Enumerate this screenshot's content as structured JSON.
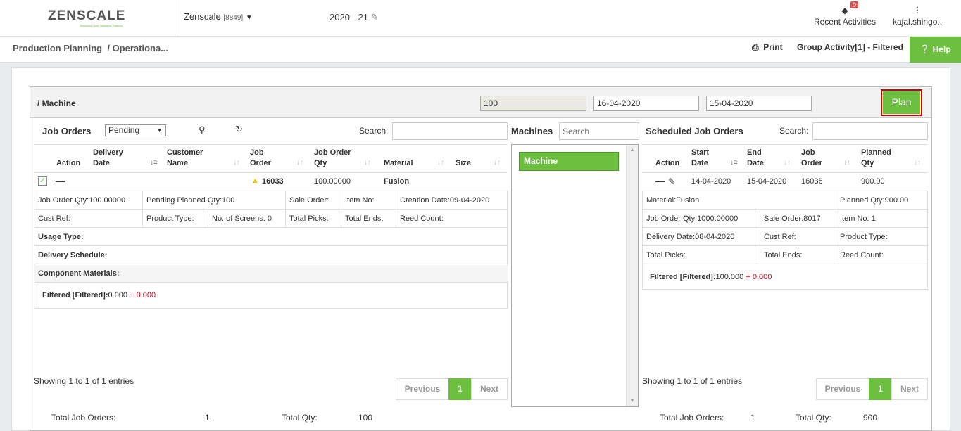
{
  "app": {
    "logo_text": "ZENSCALE",
    "logo_tagline": "Business Love. Business Passion.",
    "company": "Zenscale",
    "company_id": "[8849]",
    "fiscal_year": "2020 - 21",
    "notifications_count": "0",
    "recent_activities": "Recent Activities",
    "user": "kajal.shingo.."
  },
  "breadcrumb": {
    "root": "Production Planning",
    "current": "/ Operationa...",
    "print": "Print",
    "group_activity": "Group Activity[1] - Filtered",
    "help": "Help"
  },
  "header": {
    "title": "/ Machine",
    "qty_value": "100",
    "date_from": "16-04-2020",
    "date_to": "15-04-2020",
    "plan_button": "Plan"
  },
  "job_orders": {
    "title": "Job Orders",
    "status_filter": "Pending",
    "search_label": "Search:",
    "columns": [
      "Action",
      "Delivery Date",
      "Customer Name",
      "Job Order",
      "Job Order Qty",
      "Material",
      "Size"
    ],
    "row": {
      "job_order": "16033",
      "qty": "100.00000",
      "material": "Fusion"
    },
    "details": {
      "job_order_qty": "Job Order Qty:100.00000",
      "pending_planned_qty": "Pending Planned Qty:100",
      "sale_order": "Sale Order:",
      "item_no": "Item No:",
      "creation_date": "Creation Date:09-04-2020",
      "cust_ref": "Cust Ref:",
      "product_type": "Product Type:",
      "no_of_screens": "No. of Screens: 0",
      "total_picks": "Total Picks:",
      "total_ends": "Total Ends:",
      "reed_count": "Reed Count:",
      "usage_type": "Usage Type:",
      "delivery_schedule": "Delivery Schedule:",
      "component_materials": "Component Materials:",
      "filtered_label": "Filtered [Filtered]:",
      "filtered_value": "0.000",
      "filtered_extra": "+ 0.000"
    },
    "showing": "Showing 1 to 1 of 1 entries",
    "prev": "Previous",
    "page": "1",
    "next": "Next",
    "total_label": "Total Job Orders:",
    "total_value": "1",
    "total_qty_label": "Total Qty:",
    "total_qty_value": "100"
  },
  "machines": {
    "title": "Machines",
    "search_placeholder": "Search",
    "item": "Machine"
  },
  "scheduled": {
    "title": "Scheduled Job Orders",
    "search_label": "Search:",
    "columns": [
      "Action",
      "Start Date",
      "End Date",
      "Job Order",
      "Planned Qty"
    ],
    "row": {
      "start": "14-04-2020",
      "end": "15-04-2020",
      "job_order": "16036",
      "planned_qty": "900.00"
    },
    "details": {
      "material": "Material:Fusion",
      "planned_qty": "Planned Qty:900.00",
      "job_order_qty": "Job Order Qty:1000.00000",
      "sale_order": "Sale Order:8017",
      "item_no": "Item No: 1",
      "delivery_date": "Delivery Date:08-04-2020",
      "cust_ref": "Cust Ref:",
      "product_type": "Product Type:",
      "total_picks": "Total Picks:",
      "total_ends": "Total Ends:",
      "reed_count": "Reed Count:",
      "filtered_label": "Filtered [Filtered]:",
      "filtered_value": "100.000",
      "filtered_extra": "+ 0.000"
    },
    "showing": "Showing 1 to 1 of 1 entries",
    "prev": "Previous",
    "page": "1",
    "next": "Next",
    "total_label": "Total Job Orders:",
    "total_value": "1",
    "total_qty_label": "Total Qty:",
    "total_qty_value": "900"
  }
}
